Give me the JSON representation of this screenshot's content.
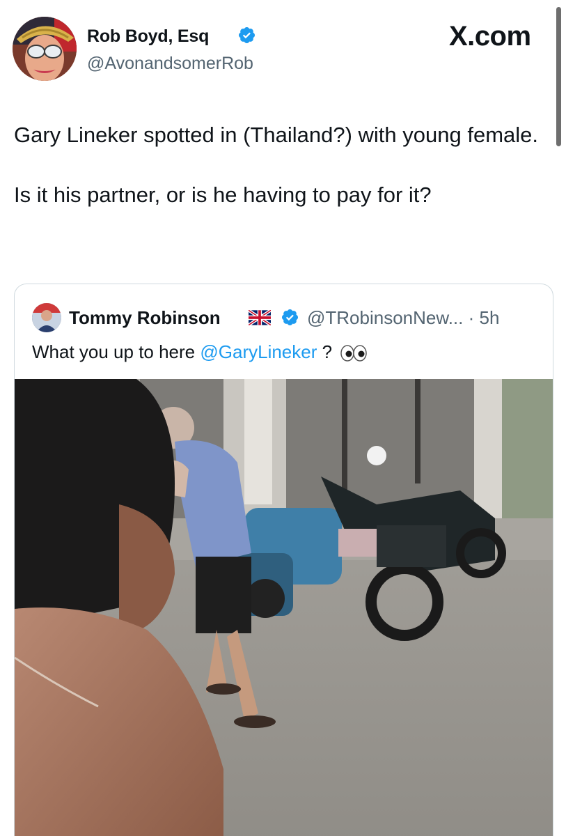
{
  "site": {
    "brand": "X.com"
  },
  "author": {
    "name": "Rob Boyd, Esq",
    "handle": "@AvonandsomerRob",
    "avatar_icon": "profile-avatar",
    "verified_icon": "verified-badge-icon"
  },
  "tweet": {
    "paragraphs": [
      "Gary Lineker spotted in (Thailand?) with young female.",
      "Is it his partner, or is he having to pay for it?"
    ]
  },
  "quoted_tweet": {
    "name": "Tommy Robinson",
    "flag_icon": "uk-flag-icon",
    "verified_icon": "verified-badge-icon",
    "handle_time": "@TRobinsonNew... · 5h",
    "text_before": "What you up to here ",
    "mention": "@GaryLineker",
    "text_after": " ?",
    "emoji_icon": "eyes-emoji-icon",
    "media": "video-frame-street-motorbikes"
  },
  "colors": {
    "verified": "#1d9bf0",
    "mention": "#1d9bf0",
    "secondary_text": "#536471",
    "border": "#cfd9de"
  }
}
